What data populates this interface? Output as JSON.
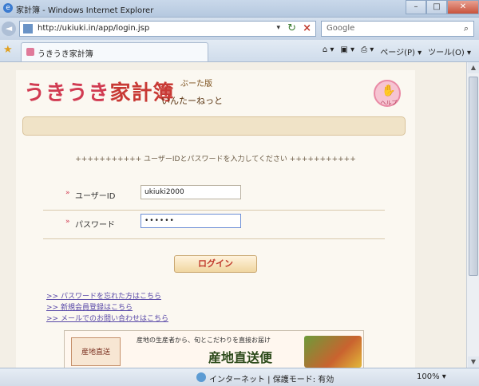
{
  "window": {
    "title": "家計簿 - Windows Internet Explorer"
  },
  "controls": {
    "minimize": "–",
    "maximize": "□",
    "close": "✕"
  },
  "navigation": {
    "back": "◄",
    "forward": "►"
  },
  "address": {
    "url": "http://ukiuki.in/app/login.jsp",
    "dropdown": "▾"
  },
  "search": {
    "value": "Google"
  },
  "tab": {
    "label": "うきうき家計簿"
  },
  "toolbar": {
    "items": [
      "ページ(P) ▾",
      "ツール(O) ▾"
    ]
  },
  "page": {
    "logo": {
      "hiragana": "うきうき",
      "kanji": "家計簿"
    },
    "logo_sub1": "ぶーた版",
    "logo_sub2": "いんたーねっと",
    "help_label": "ヘルプ",
    "instructions": "+++++++++++ ユーザーIDとパスワードを入力してください +++++++++++",
    "user_label": "ユーザーID",
    "user_value": "ukiuki2000",
    "password_label": "パスワード",
    "password_value": "••••••",
    "field_marker": "»",
    "login_label": "ログイン",
    "links": [
      ">> パスワードを忘れた方はこちら",
      ">> 新規会員登録はこちら",
      ">> メールでのお問い合わせはこちら"
    ],
    "promo": {
      "badge": "産地直送",
      "tagline": "産地の生産者から、旬とこだわりを直接お届け",
      "title": "産地直送便"
    }
  },
  "status": {
    "zone": "インターネット | 保護モード: 有効",
    "zoom": "100% ▾"
  }
}
